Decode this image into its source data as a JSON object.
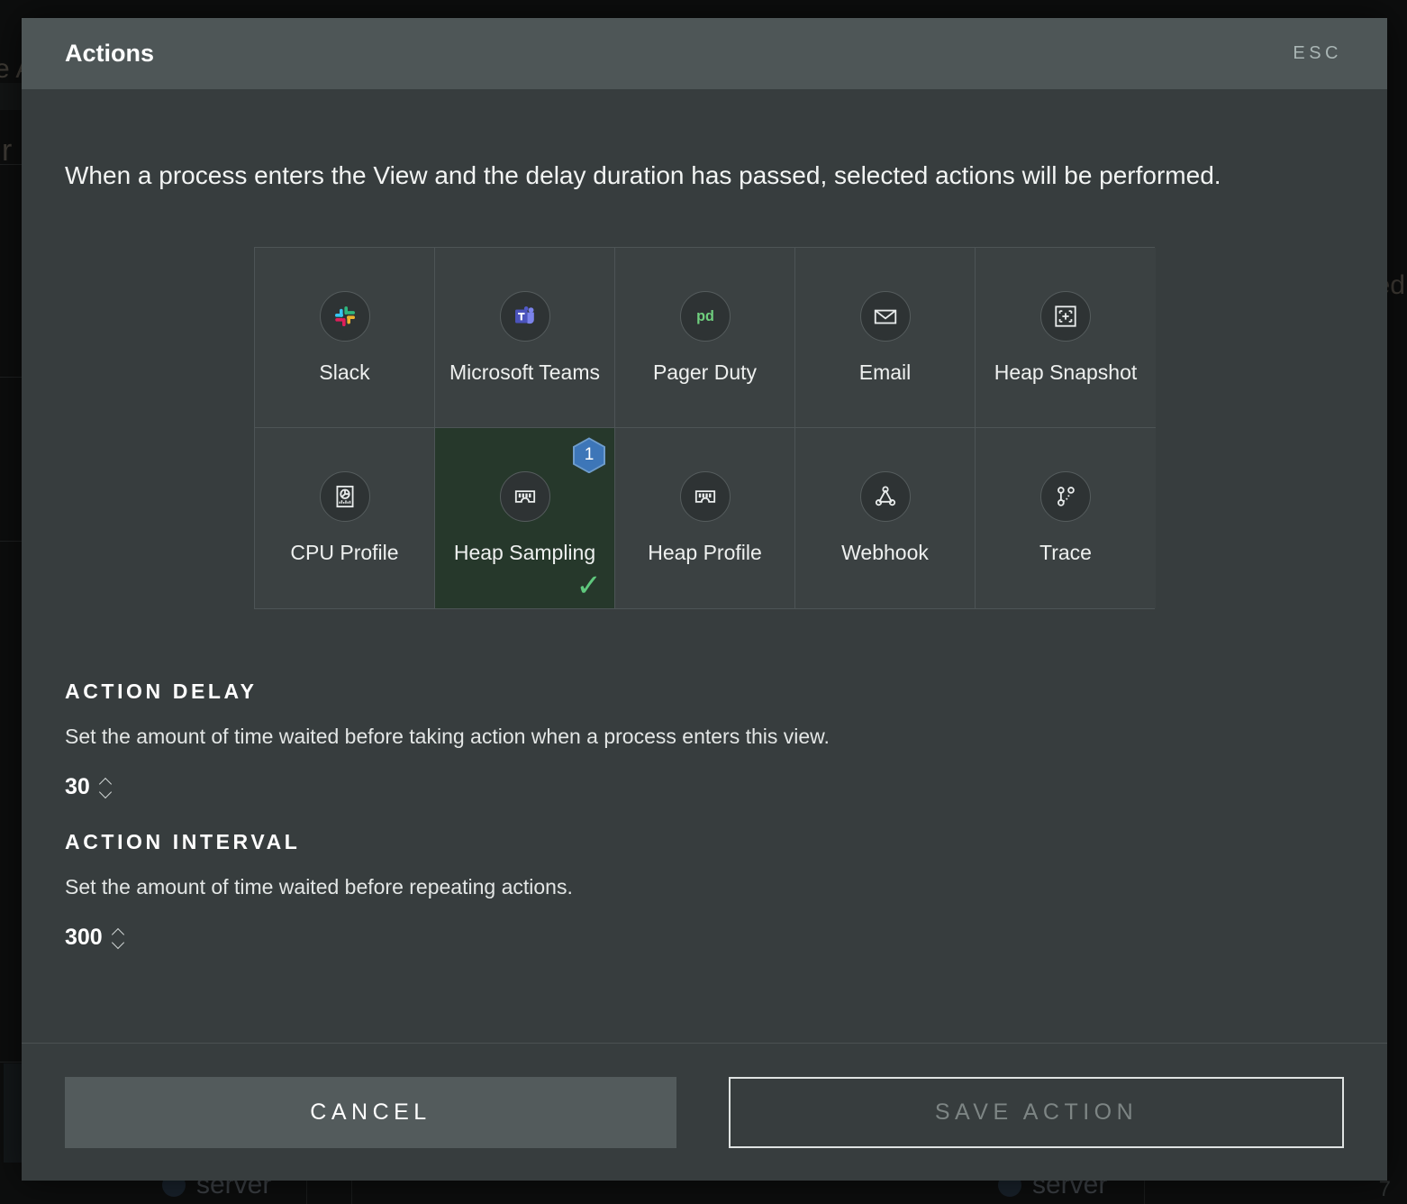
{
  "modal": {
    "title": "Actions",
    "esc_label": "ESC",
    "intro": "When a process enters the View and the delay duration has passed, selected actions will be performed."
  },
  "actions": [
    {
      "id": "slack",
      "label": "Slack",
      "icon": "slack-icon",
      "selected": false
    },
    {
      "id": "microsoft-teams",
      "label": "Microsoft Teams",
      "icon": "microsoft-teams-icon",
      "selected": false
    },
    {
      "id": "pager-duty",
      "label": "Pager Duty",
      "icon": "pager-duty-icon",
      "selected": false
    },
    {
      "id": "email",
      "label": "Email",
      "icon": "envelope-icon",
      "selected": false
    },
    {
      "id": "heap-snapshot",
      "label": "Heap Snapshot",
      "icon": "snapshot-frame-icon",
      "selected": false
    },
    {
      "id": "cpu-profile",
      "label": "CPU Profile",
      "icon": "cpu-profile-icon",
      "selected": false
    },
    {
      "id": "heap-sampling",
      "label": "Heap Sampling",
      "icon": "memory-chip-icon",
      "selected": true,
      "badge": "1",
      "check": "✓"
    },
    {
      "id": "heap-profile",
      "label": "Heap Profile",
      "icon": "memory-chip-icon",
      "selected": false
    },
    {
      "id": "webhook",
      "label": "Webhook",
      "icon": "webhook-icon",
      "selected": false
    },
    {
      "id": "trace",
      "label": "Trace",
      "icon": "trace-icon",
      "selected": false
    }
  ],
  "action_delay": {
    "title": "ACTION DELAY",
    "description": "Set the amount of time waited before taking action when a process enters this view.",
    "value": "30"
  },
  "action_interval": {
    "title": "ACTION INTERVAL",
    "description": "Set the amount of time waited before repeating actions.",
    "value": "300"
  },
  "footer": {
    "cancel_label": "CANCEL",
    "save_label": "SAVE ACTION"
  },
  "background": {
    "fragment_top_left": "e A",
    "fragment_mid_left": "r",
    "fragment_right": "ed",
    "server_label_left": "server",
    "server_label_right": "server"
  },
  "colors": {
    "modal_bg": "#373d3e",
    "header_bg": "#4e5657",
    "tile_bg": "#3b4142",
    "tile_selected_bg": "#26382b",
    "badge_blue": "#3d76b8",
    "check_green": "#5fc87d",
    "cancel_bg": "#535b5c",
    "pagerduty_green": "#6fcf7e"
  }
}
